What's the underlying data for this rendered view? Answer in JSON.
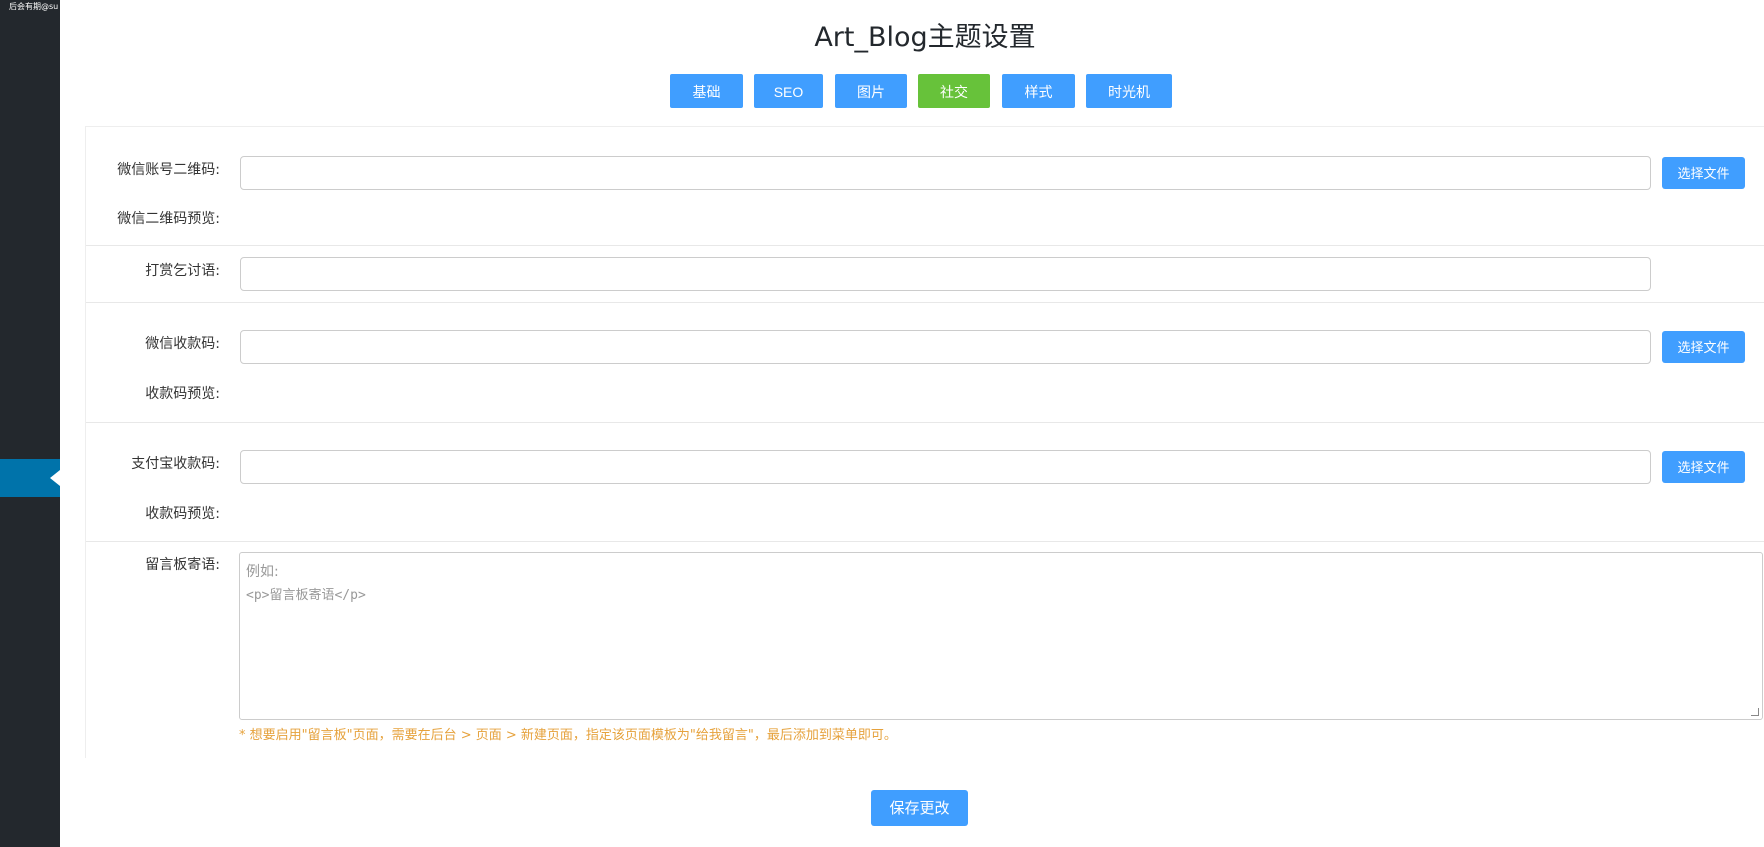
{
  "sidebar": {
    "brand_text": "后会有期@su"
  },
  "header": {
    "title": "Art_Blog主题设置"
  },
  "tabs": [
    {
      "label": "基础",
      "active": false
    },
    {
      "label": "SEO",
      "active": false
    },
    {
      "label": "图片",
      "active": false
    },
    {
      "label": "社交",
      "active": true
    },
    {
      "label": "样式",
      "active": false
    },
    {
      "label": "时光机",
      "active": false
    }
  ],
  "fields": {
    "wechat_qr": {
      "label": "微信账号二维码:",
      "value": "",
      "button": "选择文件"
    },
    "wechat_qr_preview": {
      "label": "微信二维码预览:"
    },
    "reward_text": {
      "label": "打赏乞讨语:",
      "value": ""
    },
    "wechat_pay": {
      "label": "微信收款码:",
      "value": "",
      "button": "选择文件"
    },
    "wechat_pay_preview": {
      "label": "收款码预览:"
    },
    "alipay": {
      "label": "支付宝收款码:",
      "value": "",
      "button": "选择文件"
    },
    "alipay_preview": {
      "label": "收款码预览:"
    },
    "guestbook": {
      "label": "留言板寄语:",
      "placeholder_line1": "例如:",
      "placeholder_line2": "<p>留言板寄语</p>",
      "hint": "* 想要启用\"留言板\"页面，需要在后台 > 页面 > 新建页面，指定该页面模板为\"给我留言\"，最后添加到菜单即可。"
    }
  },
  "footer": {
    "save_label": "保存更改"
  },
  "colors": {
    "primary": "#409eff",
    "active_tab": "#67c23a",
    "hint": "#e6a23c",
    "sidebar_bg": "#23282d",
    "sidebar_active": "#0073aa"
  }
}
